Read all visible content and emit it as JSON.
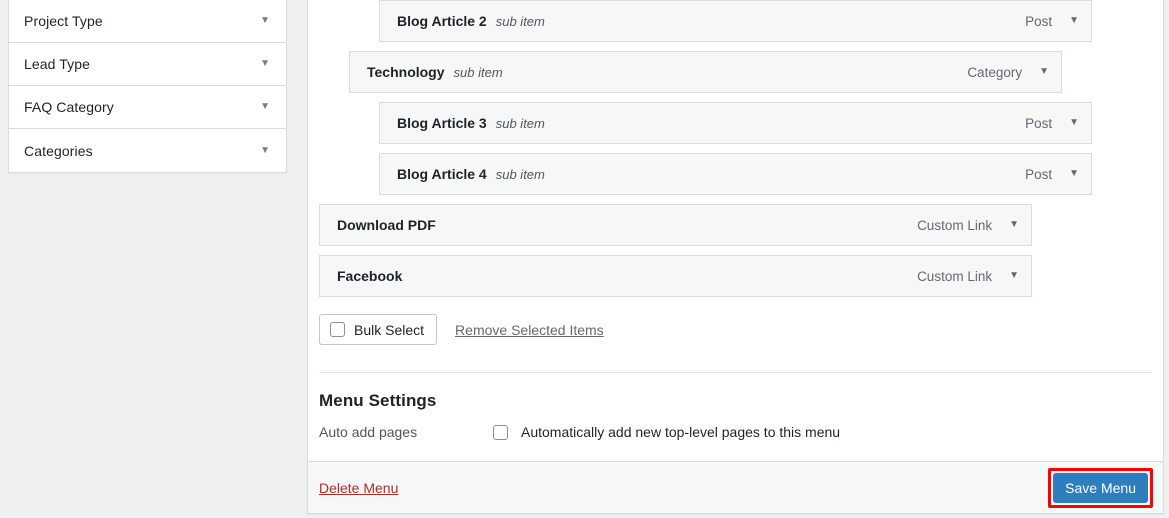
{
  "sidebar": {
    "panels": [
      {
        "label": "Project Type",
        "caret": "chevron-down-icon"
      },
      {
        "label": "Lead Type",
        "caret": "chevron-down-icon"
      },
      {
        "label": "FAQ Category",
        "caret": "chevron-down-icon"
      },
      {
        "label": "Categories",
        "caret": "chevron-down-icon"
      }
    ]
  },
  "menu_structure": {
    "items": [
      {
        "title": "Blog Article 2",
        "sub_label": "sub item",
        "type": "Post",
        "depth": 2
      },
      {
        "title": "Technology",
        "sub_label": "sub item",
        "type": "Category",
        "depth": 1
      },
      {
        "title": "Blog Article 3",
        "sub_label": "sub item",
        "type": "Post",
        "depth": 2
      },
      {
        "title": "Blog Article 4",
        "sub_label": "sub item",
        "type": "Post",
        "depth": 2
      },
      {
        "title": "Download PDF",
        "sub_label": "",
        "type": "Custom Link",
        "depth": 0
      },
      {
        "title": "Facebook",
        "sub_label": "",
        "type": "Custom Link",
        "depth": 0
      }
    ]
  },
  "bulk_actions": {
    "bulk_select_label": "Bulk Select",
    "bulk_select_checked": false,
    "remove_selected_label": "Remove Selected Items"
  },
  "menu_settings": {
    "title": "Menu Settings",
    "auto_add_label": "Auto add pages",
    "auto_add_checkbox_text": "Automatically add new top-level pages to this menu",
    "auto_add_checked": false
  },
  "footer": {
    "delete_label": "Delete Menu",
    "save_label": "Save Menu"
  },
  "colors": {
    "page_background": "#f0f0f1",
    "panel_background": "#ffffff",
    "row_background": "#f6f7f7",
    "border": "#dcdcde",
    "save_button": "#2e7ebd",
    "highlight_outline": "#ff0000",
    "delete_link": "#b32d2e",
    "text": "#1d2327",
    "muted_text": "#646970"
  }
}
